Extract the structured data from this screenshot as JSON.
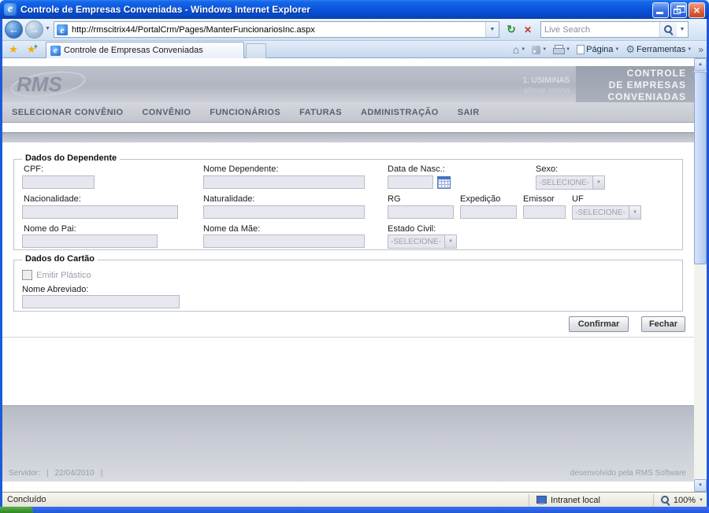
{
  "window": {
    "title": "Controle de Empresas Conveniadas - Windows Internet Explorer"
  },
  "browser": {
    "address_url": "http://rmscitrix44/PortalCrm/Pages/ManterFuncionariosInc.aspx",
    "search_placeholder": "Live Search",
    "tab_title": "Controle de Empresas Conveniadas",
    "pagina_button": "Página",
    "ferramentas_button": "Ferramentas"
  },
  "page": {
    "header": {
      "logo_text": "RMS",
      "user_line": "1: USIMINAS",
      "change_password_link": "alterar senha",
      "app_title_line1": "CONTROLE",
      "app_title_line2": "DE EMPRESAS",
      "app_title_line3": "CONVENIADAS"
    },
    "menu": {
      "items": [
        {
          "label": "SELECIONAR CONVÊNIO"
        },
        {
          "label": "CONVÊNIO"
        },
        {
          "label": "FUNCIONÁRIOS"
        },
        {
          "label": "FATURAS"
        },
        {
          "label": "ADMINISTRAÇÃO"
        },
        {
          "label": "SAIR"
        }
      ]
    },
    "dependente": {
      "legend": "Dados do Dependente",
      "cpf_label": "CPF:",
      "nome_dependente_label": "Nome Dependente:",
      "data_nasc_label": "Data de Nasc.:",
      "sexo_label": "Sexo:",
      "nacionalidade_label": "Nacionalidade:",
      "naturalidade_label": "Naturalidade:",
      "rg_label": "RG",
      "expedicao_label": "Expedição",
      "emissor_label": "Emissor",
      "uf_label": "UF",
      "nome_pai_label": "Nome do Pai:",
      "nome_mae_label": "Nome da Mãe:",
      "estado_civil_label": "Estado Civil:",
      "sexo_value": "-SELECIONE-",
      "uf_value": "-SELECIONE-",
      "estado_civil_value": "-SELECIONE-"
    },
    "cartao": {
      "legend": "Dados do Cartão",
      "emitir_plastico_label": "Emitir Plástico",
      "nome_abreviado_label": "Nome Abreviado:"
    },
    "actions": {
      "confirmar": "Confirmar",
      "fechar": "Fechar"
    },
    "footer": {
      "servidor_label": "Servidor:",
      "sep": "|",
      "date": "22/04/2010",
      "credit": "desenvolvido pela RMS Software"
    }
  },
  "statusbar": {
    "status": "Concluído",
    "zone": "Intranet local",
    "zoom": "100%"
  }
}
